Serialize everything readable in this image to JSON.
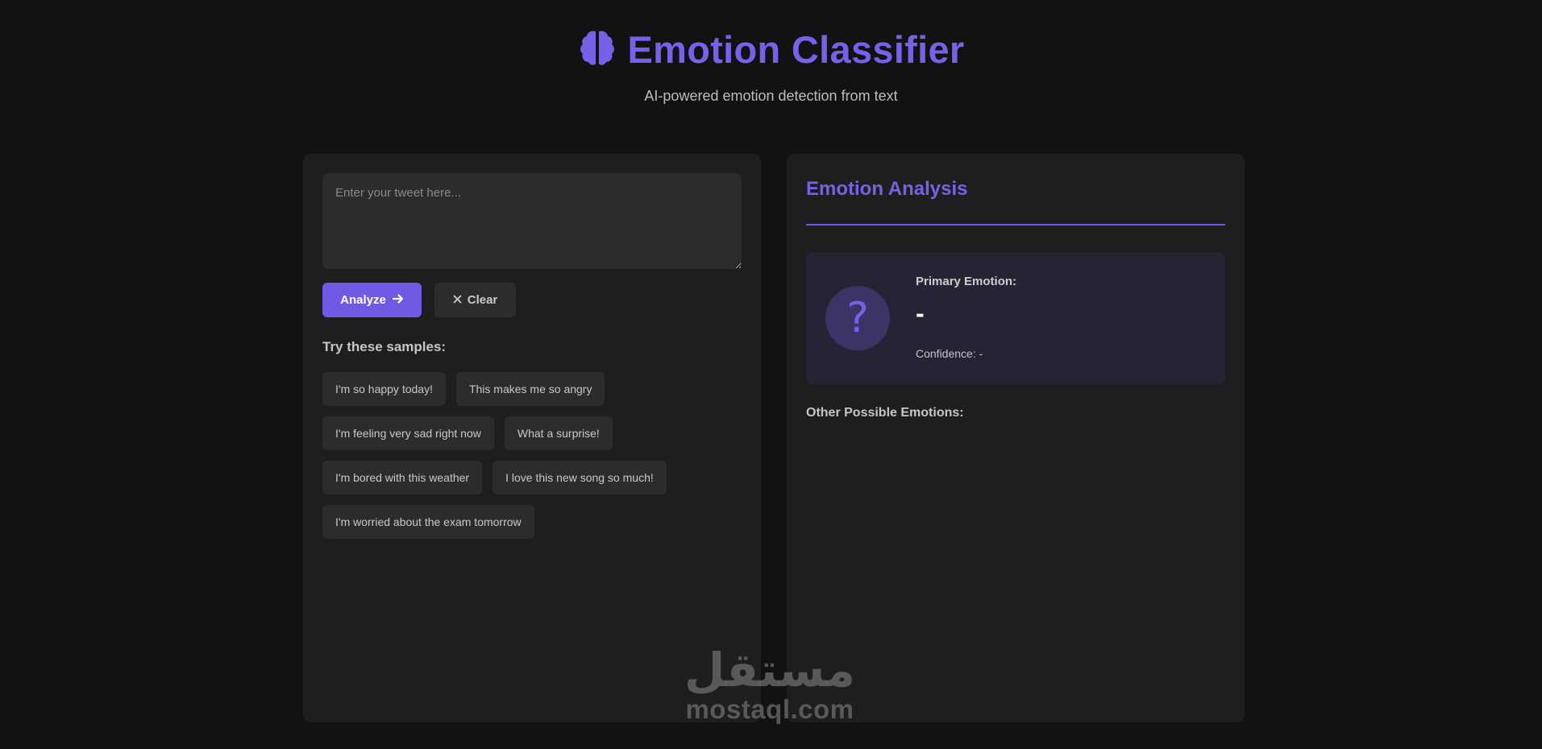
{
  "header": {
    "icon": "brain-icon",
    "title": "Emotion Classifier",
    "subtitle": "AI-powered emotion detection from text"
  },
  "input_panel": {
    "tweet_placeholder": "Enter your tweet here...",
    "tweet_value": "",
    "analyze_label": "Analyze",
    "analyze_icon": "arrow-right-icon",
    "clear_label": "Clear",
    "clear_icon": "close-icon",
    "samples_title": "Try these samples:",
    "samples": [
      "I'm so happy today!",
      "This makes me so angry",
      "I'm feeling very sad right now",
      "What a surprise!",
      "I'm bored with this weather",
      "I love this new song so much!",
      "I'm worried about the exam tomorrow"
    ]
  },
  "analysis_panel": {
    "title": "Emotion Analysis",
    "emotion_icon": "question-mark-icon",
    "emotion_glyph": "?",
    "primary_label": "Primary Emotion:",
    "primary_value": "-",
    "confidence_text": "Confidence: -",
    "other_title": "Other Possible Emotions:"
  },
  "watermark": {
    "arabic": "مستقل",
    "latin": "mostaql.com"
  },
  "colors": {
    "background": "#121212",
    "card": "#1e1e1f",
    "accent": "#7562e8",
    "button_primary": "#6f5ae6",
    "chip": "#2c2c2d",
    "result_box": "#262434"
  }
}
